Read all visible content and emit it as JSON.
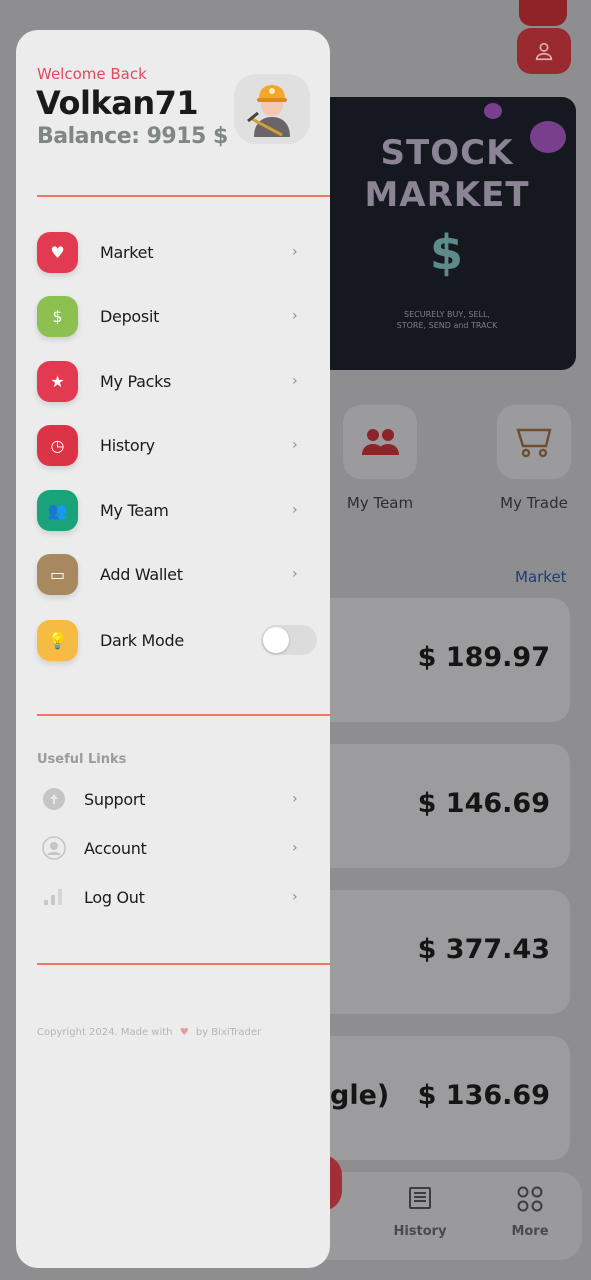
{
  "drawer": {
    "welcome": "Welcome Back",
    "username": "Volkan71",
    "balance": "Balance: 9915 $",
    "avatar_icon": "miner-avatar",
    "menu": [
      {
        "label": "Market",
        "icon": "heart-icon",
        "color": "#e23a50"
      },
      {
        "label": "Deposit",
        "icon": "deposit-icon",
        "color": "#8cc152"
      },
      {
        "label": "My Packs",
        "icon": "star-icon",
        "color": "#e23a50"
      },
      {
        "label": "History",
        "icon": "clock-icon",
        "color": "#dc3447"
      },
      {
        "label": "My Team",
        "icon": "team-icon",
        "color": "#1aa37a"
      },
      {
        "label": "Add Wallet",
        "icon": "wallet-icon",
        "color": "#a8895f"
      },
      {
        "label": "Dark Mode",
        "icon": "bulb-icon",
        "color": "#f6bb42"
      }
    ],
    "dark_mode_on": false,
    "useful_links_title": "Useful Links",
    "links": [
      {
        "label": "Support",
        "icon": "support-icon"
      },
      {
        "label": "Account",
        "icon": "account-icon"
      },
      {
        "label": "Log Out",
        "icon": "signal-icon"
      }
    ],
    "copyright_pre": "Copyright 2024. Made with",
    "copyright_post": "by BixiTrader",
    "accent": "#ea7761"
  },
  "background": {
    "banner": {
      "line1": "STOCK",
      "line2": "MARKET",
      "symbol": "$",
      "sub1": "SECURELY BUY, SELL,",
      "sub2": "STORE, SEND and TRACK"
    },
    "quick_actions": [
      {
        "label": "My Team"
      },
      {
        "label": "My Trade"
      }
    ],
    "section_link": "Market",
    "cards": [
      {
        "title": "",
        "price": "$ 189.97"
      },
      {
        "title": "",
        "price": "$ 146.69"
      },
      {
        "title": "",
        "price": "$ 377.43"
      },
      {
        "title": "gle)",
        "price": "$ 136.69"
      }
    ],
    "nav": [
      {
        "label": "History"
      },
      {
        "label": "More"
      }
    ]
  }
}
